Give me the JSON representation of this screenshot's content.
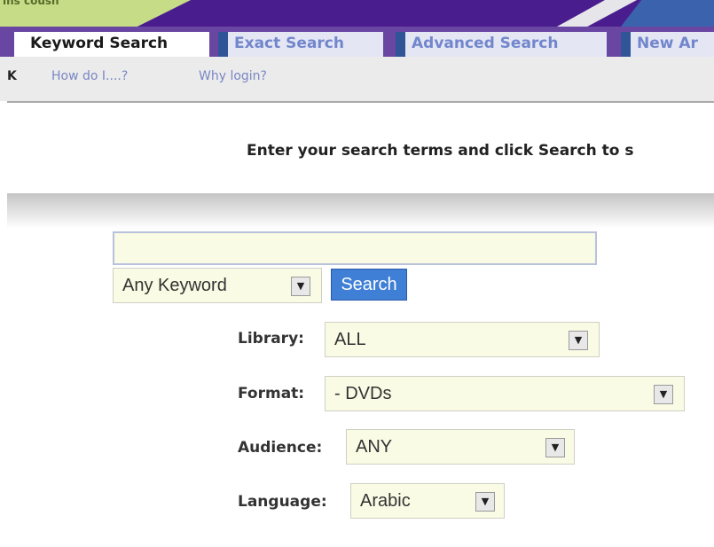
{
  "banner": {
    "partial_text": "ins cousn"
  },
  "tabs": [
    {
      "label": "Keyword Search",
      "active": true
    },
    {
      "label": "Exact Search",
      "active": false
    },
    {
      "label": "Advanced Search",
      "active": false
    },
    {
      "label": "New Ar",
      "active": false
    }
  ],
  "subnav": {
    "partial_letter": "K",
    "links": [
      "How do I....?",
      "Why login?"
    ]
  },
  "instruction": "Enter your search terms and click Search to s",
  "search": {
    "value": "",
    "keyword_type": "Any Keyword",
    "button_label": "Search"
  },
  "filters": {
    "library": {
      "label": "Library:",
      "value": "ALL"
    },
    "format": {
      "label": "Format:",
      "value": "- DVDs"
    },
    "audience": {
      "label": "Audience:",
      "value": "ANY"
    },
    "language": {
      "label": "Language:",
      "value": "Arabic"
    }
  },
  "colors": {
    "header_purple": "#4a1d8e",
    "tab_blue": "#2f5597",
    "inactive_tab_text": "#7286cc",
    "field_bg": "#fafbe4",
    "button_blue": "#3f7fd6"
  },
  "icons": {
    "dropdown_arrow": "▼"
  }
}
